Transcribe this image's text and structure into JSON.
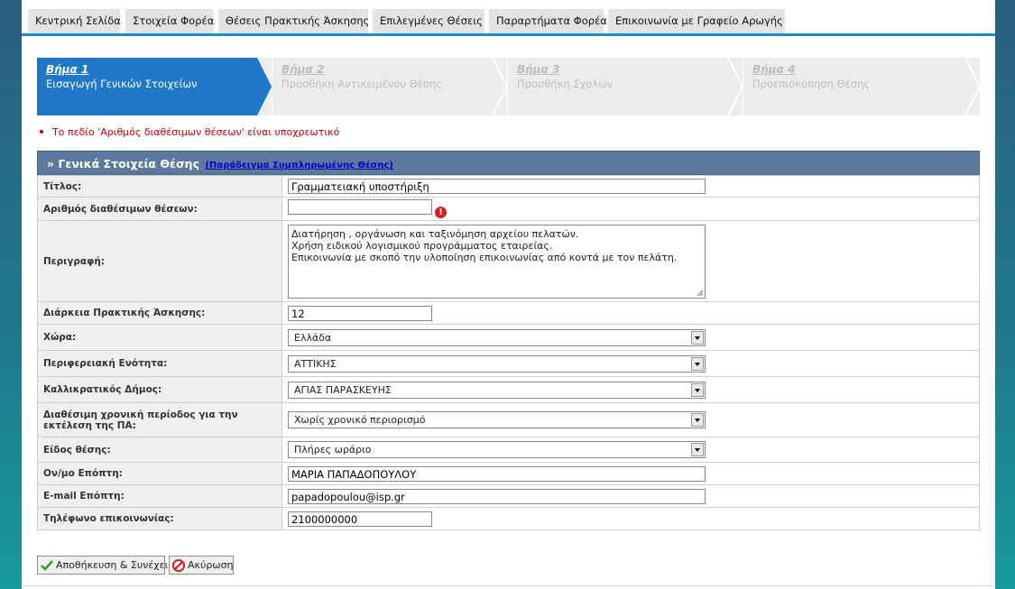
{
  "nav": {
    "items": [
      "Κεντρική Σελίδα",
      "Στοιχεία Φορέα",
      "Θέσεις Πρακτικής Άσκησης",
      "Επιλεγμένες Θέσεις",
      "Παραρτήματα Φορέα",
      "Επικοινωνία με Γραφείο Αρωγής"
    ]
  },
  "wizard": {
    "steps": [
      {
        "title": "Βήμα 1",
        "subtitle": "Εισαγωγή Γενικών Στοιχείων",
        "state": "active"
      },
      {
        "title": "Βήμα 2",
        "subtitle": "Προσθήκη Αντικειμένου Θέσης",
        "state": "inactive"
      },
      {
        "title": "Βήμα 3",
        "subtitle": "Προσθήκη Σχολών",
        "state": "inactive"
      },
      {
        "title": "Βήμα 4",
        "subtitle": "Προεπισκόπηση Θέσης",
        "state": "inactive"
      }
    ]
  },
  "error_message": "Το πεδίο 'Αριθμός διαθέσιμων θέσεων' είναι υποχρεωτικό",
  "form": {
    "header_title": "» Γενικά Στοιχεία Θέσης",
    "header_link": "(Παράδειγμα Συμπληρωμένης Θέσης)",
    "fields": {
      "title": {
        "label": "Τίτλος:",
        "value": "Γραμματειακή υποστήριξη"
      },
      "positions": {
        "label": "Αριθμός διαθέσιμων θέσεων:",
        "value": "",
        "error_icon": "!"
      },
      "description": {
        "label": "Περιγραφή:",
        "value": "Διατήρηση , οργάνωση και ταξινόμηση αρχείου πελατών.\nΧρήση ειδικού λογισμικού προγράμματος εταιρείας.\nΕπικοινωνία με σκοπό την  υλοποίηση επικοινωνίας από κοντά με τον πελάτη."
      },
      "duration": {
        "label": "Διάρκεια Πρακτικής Άσκησης:",
        "value": "12"
      },
      "country": {
        "label": "Χώρα:",
        "value": "Ελλάδα"
      },
      "region": {
        "label": "Περιφερειακή Ενότητα:",
        "value": "ΑΤΤΙΚΗΣ"
      },
      "municipality": {
        "label": "Καλλικρατικός Δήμος:",
        "value": "ΑΓΙΑΣ ΠΑΡΑΣΚΕΥΗΣ"
      },
      "period": {
        "label": "Διαθέσιμη χρονική περίοδος για την εκτέλεση της ΠΑ:",
        "value": "Χωρίς χρονικό περιορισμό"
      },
      "type": {
        "label": "Είδος θέσης:",
        "value": "Πλήρες ωράριο"
      },
      "supervisor": {
        "label": "Ον/μο Επόπτη:",
        "value": "ΜΑΡΙΑ ΠΑΠΑΔΟΠΟΥΛΟΥ"
      },
      "email": {
        "label": "E-mail Επόπτη:",
        "value": "papadopoulou@isp.gr"
      },
      "phone": {
        "label": "Τηλέφωνο επικοινωνίας:",
        "value": "2100000000"
      }
    }
  },
  "buttons": {
    "save": "Αποθήκευση & Συνέχεια",
    "cancel": "Ακύρωση"
  },
  "colors": {
    "accent": "#1f78c8",
    "header": "#5b7a9c",
    "error": "#cc0000"
  }
}
